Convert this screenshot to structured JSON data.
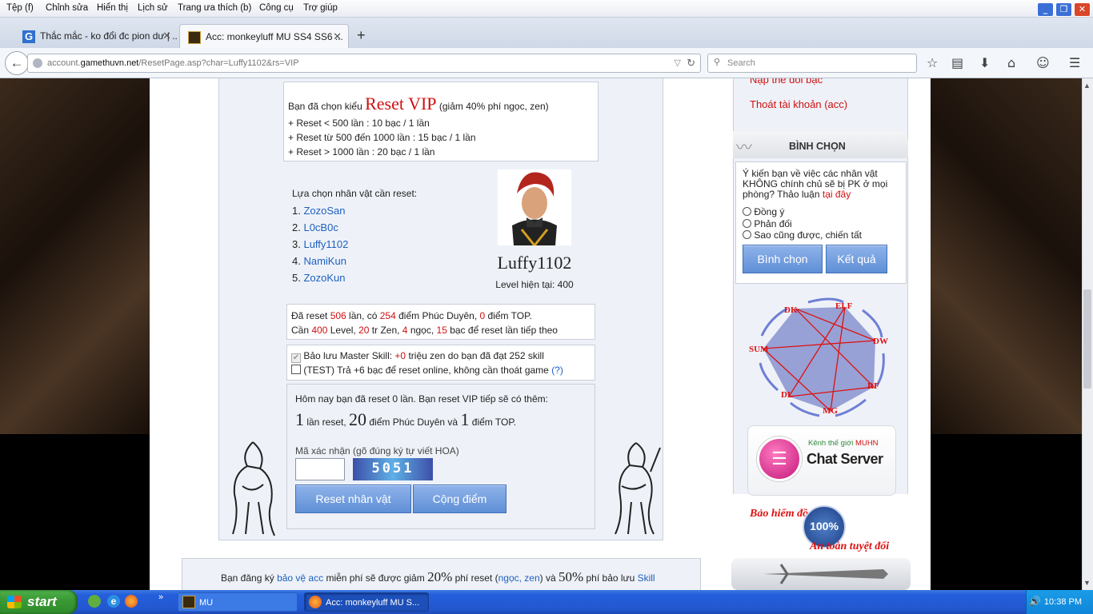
{
  "menubar": [
    "Tệp (f)",
    "Chỉnh sửa",
    "Hiển thị",
    "Lịch sử",
    "Trang ưa thích (b)",
    "Công cụ",
    "Trợ giúp"
  ],
  "tabs": [
    {
      "label": "Thắc mắc - ko đổi đc pion dư | ..."
    },
    {
      "label": "Acc: monkeyluff MU SS4 SS6 ..."
    }
  ],
  "url": {
    "prefix": "account.",
    "domain": "gamethuvn.net",
    "path": "/ResetPage.asp?char=Luffy1102&rs=VIP"
  },
  "search": {
    "placeholder": "Search"
  },
  "reset": {
    "intro": "Bạn đã chọn kiểu",
    "type": "Reset VIP",
    "discount": "(giảm 40% phí ngọc, zen)",
    "tiers": [
      "+ Reset < 500 lần : 10 bạc / 1 lần",
      "+ Reset từ 500 đến 1000 lần : 15 bạc / 1 lần",
      "+ Reset > 1000 lần : 20 bạc / 1 lần"
    ]
  },
  "chars": {
    "heading": "Lựa chọn nhân vật cần reset:",
    "list": [
      "ZozoSan",
      "L0cB0c",
      "Luffy1102",
      "NamiKun",
      "ZozoKun"
    ]
  },
  "selected": {
    "name": "Luffy1102",
    "level_label": "Level hiện tại: 400"
  },
  "stats": {
    "l1a": "Đã reset ",
    "resets": "506",
    "l1b": " lần, có ",
    "luck": "254",
    "l1c": " điểm Phúc Duyên, ",
    "top": "0",
    "l1d": " điểm TOP.",
    "l2a": "Cần ",
    "lvl": "400",
    "l2b": " Level, ",
    "zen": "20",
    "l2c": " tr Zen, ",
    "gems": "4",
    "l2d": " ngọc, ",
    "silver": "15",
    "l2e": " bạc để reset lần tiếp theo"
  },
  "opts": {
    "o1a": "Bảo lưu Master Skill: ",
    "o1b": "+0",
    "o1c": " triệu zen do bạn đã đạt 252 skill",
    "o2a": "(TEST) Trả +6 bạc để reset online, không cần thoát game ",
    "o2b": "(?)"
  },
  "bonus": {
    "line1": "Hôm nay bạn đã reset 0 lần. Bạn reset VIP tiếp sẽ có thêm:",
    "n1": "1",
    "t1": " lần reset, ",
    "n2": "20",
    "t2": " điểm Phúc Duyên và ",
    "n3": "1",
    "t3": " điểm TOP."
  },
  "captcha": {
    "label": "Mã xác nhận (gõ đúng ký tự viết HOA)",
    "code": "5051"
  },
  "buttons": {
    "reset": "Reset nhân vật",
    "add": "Cộng điểm"
  },
  "bottom": {
    "a": "Bạn đăng ký ",
    "b": "bảo vệ acc",
    "c": " miễn phí sẽ được giảm ",
    "d": "20%",
    "e": " phí reset (",
    "f": "ngọc, zen",
    "g": ") và ",
    "h": "50%",
    "i": " phí bảo lưu ",
    "j": "Skill"
  },
  "side": {
    "links": [
      "Nạp thẻ đổi bạc",
      "Thoát tài khoản (acc)"
    ],
    "poll_title": "BÌNH CHỌN",
    "poll_q": "Ý kiến bạn về việc các nhân vật KHÔNG chính chủ sẽ bị PK ở mọi phòng? Thảo luận ",
    "poll_link": "tại đây",
    "options": [
      "Đồng ý",
      "Phản đối",
      "Sao cũng được, chiến tất"
    ],
    "vote": "Bình chọn",
    "result": "Kết quả",
    "classes": [
      "DK",
      "ELF",
      "DW",
      "RF",
      "MG",
      "DL",
      "SUM"
    ],
    "chat_top": "Kênh thế giới ",
    "chat_brand": "MUHN",
    "chat": "Chat Server",
    "insure1": "Bảo hiểm đồ",
    "insure_pct": "100%",
    "insure2": "An toàn tuyệt đối"
  },
  "taskbar": {
    "start": "start",
    "items": [
      "MU",
      "Acc: monkeyluff MU S..."
    ],
    "clock": "10:38 PM"
  }
}
